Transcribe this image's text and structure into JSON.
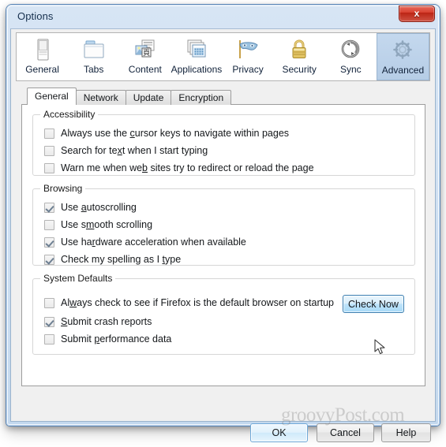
{
  "window": {
    "title": "Options",
    "close_label": "x"
  },
  "toolbar": {
    "items": [
      {
        "label": "General",
        "icon": "general-icon",
        "selected": false
      },
      {
        "label": "Tabs",
        "icon": "tabs-icon",
        "selected": false
      },
      {
        "label": "Content",
        "icon": "content-icon",
        "selected": false
      },
      {
        "label": "Applications",
        "icon": "applications-icon",
        "selected": false
      },
      {
        "label": "Privacy",
        "icon": "privacy-mask-icon",
        "selected": false
      },
      {
        "label": "Security",
        "icon": "padlock-icon",
        "selected": false
      },
      {
        "label": "Sync",
        "icon": "sync-icon",
        "selected": false
      },
      {
        "label": "Advanced",
        "icon": "gear-icon",
        "selected": true
      }
    ]
  },
  "tabs": [
    {
      "label": "General",
      "selected": true
    },
    {
      "label": "Network",
      "selected": false
    },
    {
      "label": "Update",
      "selected": false
    },
    {
      "label": "Encryption",
      "selected": false
    }
  ],
  "groups": {
    "accessibility": {
      "title": "Accessibility",
      "options": [
        {
          "pre": "Always use the ",
          "key": "c",
          "post": "ursor keys to navigate within pages",
          "checked": false
        },
        {
          "pre": "Search for te",
          "key": "x",
          "post": "t when I start typing",
          "checked": false
        },
        {
          "pre": "Warn me when we",
          "key": "b",
          "post": " sites try to redirect or reload the page",
          "checked": false
        }
      ]
    },
    "browsing": {
      "title": "Browsing",
      "options": [
        {
          "pre": "Use ",
          "key": "a",
          "post": "utoscrolling",
          "checked": true
        },
        {
          "pre": "Use s",
          "key": "m",
          "post": "ooth scrolling",
          "checked": false
        },
        {
          "pre": "Use ha",
          "key": "r",
          "post": "dware acceleration when available",
          "checked": true
        },
        {
          "pre": "Check my spelling as I ",
          "key": "t",
          "post": "ype",
          "checked": true
        }
      ]
    },
    "system_defaults": {
      "title": "System Defaults",
      "options": [
        {
          "pre": "Al",
          "key": "w",
          "post": "ays check to see if Firefox is the default browser on startup",
          "checked": false
        },
        {
          "pre": "",
          "key": "S",
          "post": "ubmit crash reports",
          "checked": true
        },
        {
          "pre": "Submit ",
          "key": "p",
          "post": "erformance data",
          "checked": false
        }
      ],
      "check_now_label": "Check Now"
    }
  },
  "footer": {
    "ok_label": "OK",
    "cancel_label": "Cancel",
    "help_label": "Help"
  },
  "watermark": "groovyPost.com",
  "colors": {
    "titlebar_start": "#d7e5f4",
    "titlebar_end": "#c3d8ee",
    "window_border": "#5a85b5",
    "close_red": "#d8402f",
    "selected_tab_blue": "#b6cde6",
    "default_button_blue": "#6ea8d8",
    "hover_button_blue": "#3c7fb1",
    "client_bg": "#f0f0f0",
    "panel_bg": "#ffffff"
  }
}
